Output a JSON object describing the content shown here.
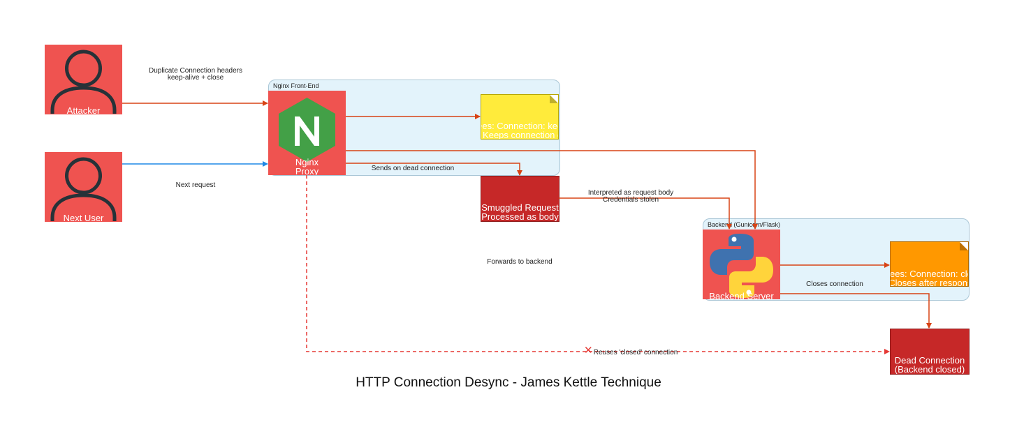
{
  "title": "HTTP Connection Desync - James Kettle Technique",
  "colors": {
    "red_node": "#ef5350",
    "dark_red": "#c62828",
    "yellow_note": "#ffeb3b",
    "orange_note": "#ff9800",
    "cluster_bg": "#e3f3fb",
    "edge_red": "#d84315",
    "edge_blue": "#1e88e5",
    "nginx_green": "#43a047",
    "python_blue": "#3f72af",
    "python_yellow": "#ffd43b"
  },
  "clusters": {
    "frontend": {
      "title": "Nginx Front-End"
    },
    "backend": {
      "title": "Backend (Gunicorn/Flask)"
    }
  },
  "nodes": {
    "attacker": {
      "label": "Attacker",
      "icon": "user-icon"
    },
    "next_user": {
      "label": "Next User",
      "icon": "user-icon"
    },
    "nginx": {
      "label_line1": "Nginx",
      "label_line2": "Proxy",
      "icon": "nginx-icon"
    },
    "backend_server": {
      "label": "Backend Server",
      "icon": "python-icon"
    },
    "note_keepalive": {
      "line1": "Sees: Connection: keep-alive",
      "line2": "Keeps connection open"
    },
    "note_close": {
      "line1": "Sees: Connection: close",
      "line2": "Closes after response"
    },
    "smuggled": {
      "line1": "Smuggled Request",
      "line2": "Processed as body"
    },
    "dead_connection": {
      "line1": "Dead Connection",
      "line2": "(Backend closed)"
    }
  },
  "edge_labels": {
    "duplicate_line1": "Duplicate Connection headers",
    "duplicate_line2": "keep-alive + close",
    "next_request": "Next request",
    "sends_dead": "Sends on dead connection",
    "interpreted_line1": "Interpreted as request body",
    "interpreted_line2": "Credentials stolen",
    "forwards": "Forwards to backend",
    "closes": "Closes connection",
    "reuses": "Reuses 'closed' connection",
    "reuses_mark": "✕"
  }
}
